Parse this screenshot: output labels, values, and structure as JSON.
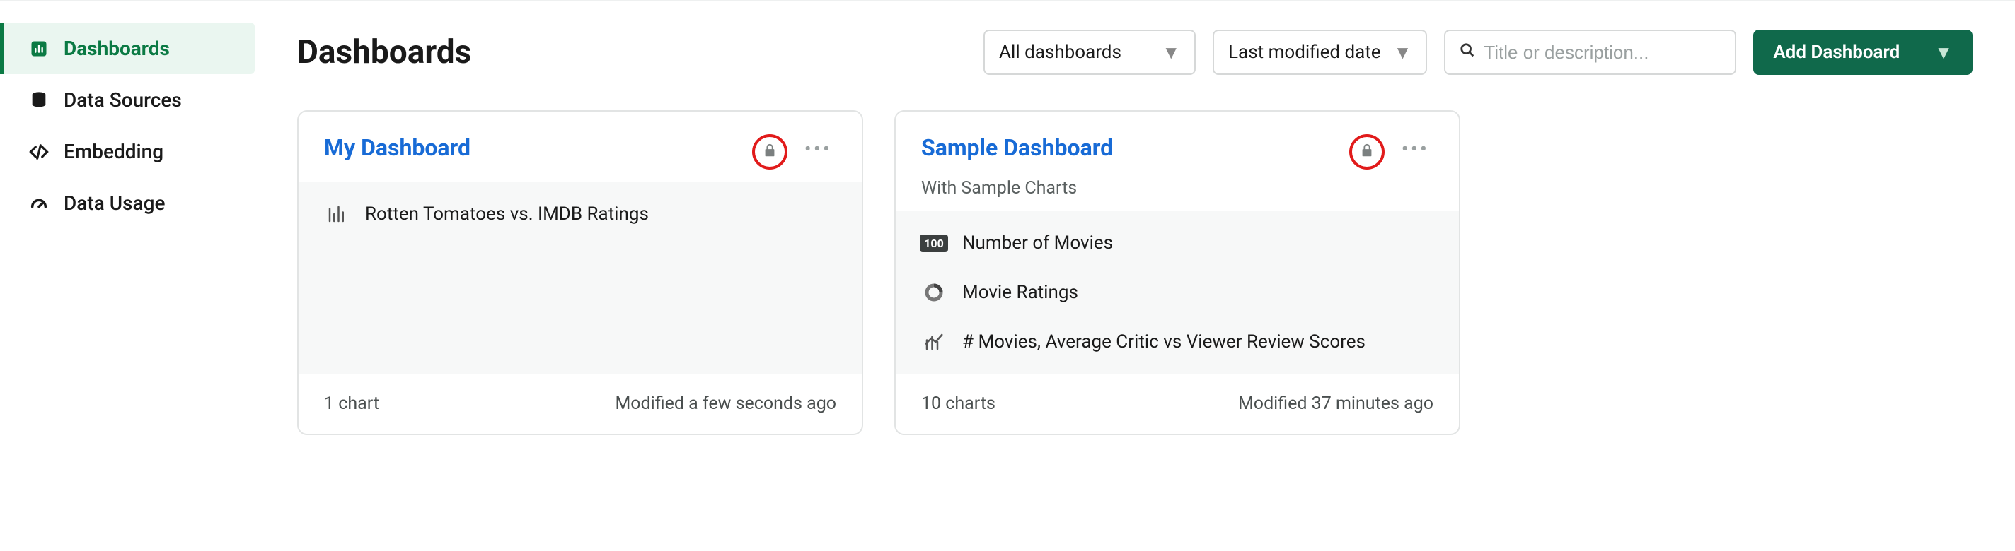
{
  "sidebar": {
    "items": [
      {
        "label": "Dashboards"
      },
      {
        "label": "Data Sources"
      },
      {
        "label": "Embedding"
      },
      {
        "label": "Data Usage"
      }
    ]
  },
  "page": {
    "title": "Dashboards"
  },
  "filters": {
    "view": "All dashboards",
    "sort": "Last modified date"
  },
  "search": {
    "placeholder": "Title or description..."
  },
  "actions": {
    "add": "Add Dashboard"
  },
  "cards": [
    {
      "title": "My Dashboard",
      "subtitle": "",
      "charts": [
        {
          "icon": "bar",
          "label": "Rotten Tomatoes vs. IMDB Ratings"
        }
      ],
      "count": "1 chart",
      "modified": "Modified a few seconds ago"
    },
    {
      "title": "Sample Dashboard",
      "subtitle": "With Sample Charts",
      "charts": [
        {
          "icon": "num",
          "label": "Number of Movies"
        },
        {
          "icon": "donut",
          "label": "Movie Ratings"
        },
        {
          "icon": "combo",
          "label": "# Movies, Average Critic vs Viewer Review Scores"
        }
      ],
      "count": "10 charts",
      "modified": "Modified 37 minutes ago"
    }
  ]
}
